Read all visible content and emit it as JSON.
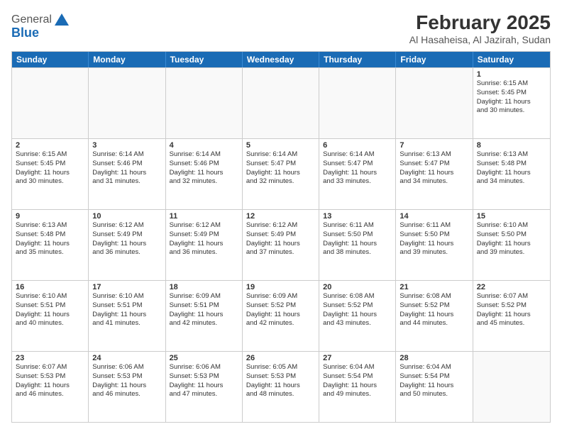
{
  "header": {
    "logo_general": "General",
    "logo_blue": "Blue",
    "month_year": "February 2025",
    "location": "Al Hasaheisa, Al Jazirah, Sudan"
  },
  "days_of_week": [
    "Sunday",
    "Monday",
    "Tuesday",
    "Wednesday",
    "Thursday",
    "Friday",
    "Saturday"
  ],
  "weeks": [
    {
      "cells": [
        {
          "day": "",
          "empty": true
        },
        {
          "day": "",
          "empty": true
        },
        {
          "day": "",
          "empty": true
        },
        {
          "day": "",
          "empty": true
        },
        {
          "day": "",
          "empty": true
        },
        {
          "day": "",
          "empty": true
        },
        {
          "day": "1",
          "sunrise": "Sunrise: 6:15 AM",
          "sunset": "Sunset: 5:45 PM",
          "daylight": "Daylight: 11 hours",
          "daylight2": "and 30 minutes."
        }
      ]
    },
    {
      "cells": [
        {
          "day": "2",
          "sunrise": "Sunrise: 6:15 AM",
          "sunset": "Sunset: 5:45 PM",
          "daylight": "Daylight: 11 hours",
          "daylight2": "and 30 minutes."
        },
        {
          "day": "3",
          "sunrise": "Sunrise: 6:14 AM",
          "sunset": "Sunset: 5:46 PM",
          "daylight": "Daylight: 11 hours",
          "daylight2": "and 31 minutes."
        },
        {
          "day": "4",
          "sunrise": "Sunrise: 6:14 AM",
          "sunset": "Sunset: 5:46 PM",
          "daylight": "Daylight: 11 hours",
          "daylight2": "and 32 minutes."
        },
        {
          "day": "5",
          "sunrise": "Sunrise: 6:14 AM",
          "sunset": "Sunset: 5:47 PM",
          "daylight": "Daylight: 11 hours",
          "daylight2": "and 32 minutes."
        },
        {
          "day": "6",
          "sunrise": "Sunrise: 6:14 AM",
          "sunset": "Sunset: 5:47 PM",
          "daylight": "Daylight: 11 hours",
          "daylight2": "and 33 minutes."
        },
        {
          "day": "7",
          "sunrise": "Sunrise: 6:13 AM",
          "sunset": "Sunset: 5:47 PM",
          "daylight": "Daylight: 11 hours",
          "daylight2": "and 34 minutes."
        },
        {
          "day": "8",
          "sunrise": "Sunrise: 6:13 AM",
          "sunset": "Sunset: 5:48 PM",
          "daylight": "Daylight: 11 hours",
          "daylight2": "and 34 minutes."
        }
      ]
    },
    {
      "cells": [
        {
          "day": "9",
          "sunrise": "Sunrise: 6:13 AM",
          "sunset": "Sunset: 5:48 PM",
          "daylight": "Daylight: 11 hours",
          "daylight2": "and 35 minutes."
        },
        {
          "day": "10",
          "sunrise": "Sunrise: 6:12 AM",
          "sunset": "Sunset: 5:49 PM",
          "daylight": "Daylight: 11 hours",
          "daylight2": "and 36 minutes."
        },
        {
          "day": "11",
          "sunrise": "Sunrise: 6:12 AM",
          "sunset": "Sunset: 5:49 PM",
          "daylight": "Daylight: 11 hours",
          "daylight2": "and 36 minutes."
        },
        {
          "day": "12",
          "sunrise": "Sunrise: 6:12 AM",
          "sunset": "Sunset: 5:49 PM",
          "daylight": "Daylight: 11 hours",
          "daylight2": "and 37 minutes."
        },
        {
          "day": "13",
          "sunrise": "Sunrise: 6:11 AM",
          "sunset": "Sunset: 5:50 PM",
          "daylight": "Daylight: 11 hours",
          "daylight2": "and 38 minutes."
        },
        {
          "day": "14",
          "sunrise": "Sunrise: 6:11 AM",
          "sunset": "Sunset: 5:50 PM",
          "daylight": "Daylight: 11 hours",
          "daylight2": "and 39 minutes."
        },
        {
          "day": "15",
          "sunrise": "Sunrise: 6:10 AM",
          "sunset": "Sunset: 5:50 PM",
          "daylight": "Daylight: 11 hours",
          "daylight2": "and 39 minutes."
        }
      ]
    },
    {
      "cells": [
        {
          "day": "16",
          "sunrise": "Sunrise: 6:10 AM",
          "sunset": "Sunset: 5:51 PM",
          "daylight": "Daylight: 11 hours",
          "daylight2": "and 40 minutes."
        },
        {
          "day": "17",
          "sunrise": "Sunrise: 6:10 AM",
          "sunset": "Sunset: 5:51 PM",
          "daylight": "Daylight: 11 hours",
          "daylight2": "and 41 minutes."
        },
        {
          "day": "18",
          "sunrise": "Sunrise: 6:09 AM",
          "sunset": "Sunset: 5:51 PM",
          "daylight": "Daylight: 11 hours",
          "daylight2": "and 42 minutes."
        },
        {
          "day": "19",
          "sunrise": "Sunrise: 6:09 AM",
          "sunset": "Sunset: 5:52 PM",
          "daylight": "Daylight: 11 hours",
          "daylight2": "and 42 minutes."
        },
        {
          "day": "20",
          "sunrise": "Sunrise: 6:08 AM",
          "sunset": "Sunset: 5:52 PM",
          "daylight": "Daylight: 11 hours",
          "daylight2": "and 43 minutes."
        },
        {
          "day": "21",
          "sunrise": "Sunrise: 6:08 AM",
          "sunset": "Sunset: 5:52 PM",
          "daylight": "Daylight: 11 hours",
          "daylight2": "and 44 minutes."
        },
        {
          "day": "22",
          "sunrise": "Sunrise: 6:07 AM",
          "sunset": "Sunset: 5:52 PM",
          "daylight": "Daylight: 11 hours",
          "daylight2": "and 45 minutes."
        }
      ]
    },
    {
      "cells": [
        {
          "day": "23",
          "sunrise": "Sunrise: 6:07 AM",
          "sunset": "Sunset: 5:53 PM",
          "daylight": "Daylight: 11 hours",
          "daylight2": "and 46 minutes."
        },
        {
          "day": "24",
          "sunrise": "Sunrise: 6:06 AM",
          "sunset": "Sunset: 5:53 PM",
          "daylight": "Daylight: 11 hours",
          "daylight2": "and 46 minutes."
        },
        {
          "day": "25",
          "sunrise": "Sunrise: 6:06 AM",
          "sunset": "Sunset: 5:53 PM",
          "daylight": "Daylight: 11 hours",
          "daylight2": "and 47 minutes."
        },
        {
          "day": "26",
          "sunrise": "Sunrise: 6:05 AM",
          "sunset": "Sunset: 5:53 PM",
          "daylight": "Daylight: 11 hours",
          "daylight2": "and 48 minutes."
        },
        {
          "day": "27",
          "sunrise": "Sunrise: 6:04 AM",
          "sunset": "Sunset: 5:54 PM",
          "daylight": "Daylight: 11 hours",
          "daylight2": "and 49 minutes."
        },
        {
          "day": "28",
          "sunrise": "Sunrise: 6:04 AM",
          "sunset": "Sunset: 5:54 PM",
          "daylight": "Daylight: 11 hours",
          "daylight2": "and 50 minutes."
        },
        {
          "day": "",
          "empty": true
        }
      ]
    }
  ]
}
